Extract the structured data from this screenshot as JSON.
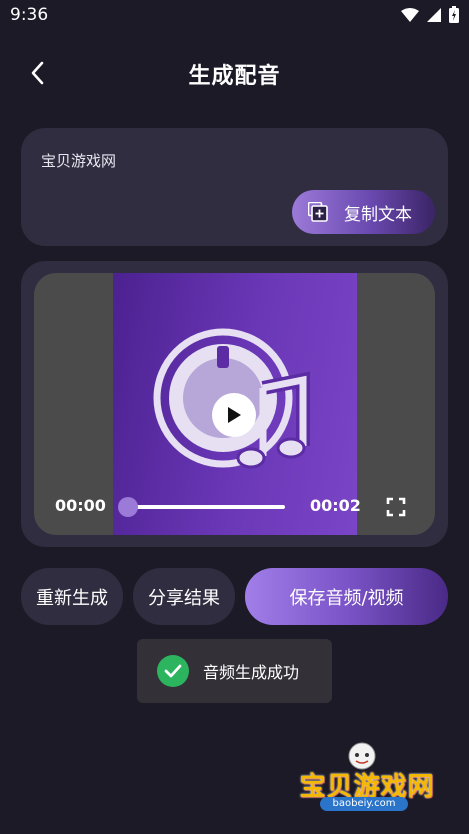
{
  "status": {
    "time": "9:36"
  },
  "header": {
    "title": "生成配音"
  },
  "text_card": {
    "content": "宝贝游戏网",
    "copy_label": "复制文本"
  },
  "player": {
    "current_time": "00:00",
    "duration": "00:02",
    "progress": 0
  },
  "actions": {
    "regen_label": "重新生成",
    "share_label": "分享结果",
    "save_label": "保存音频/视频"
  },
  "toast": {
    "message": "音频生成成功"
  },
  "watermark": {
    "brand": "宝贝游戏网",
    "url": "baobeiy.com"
  },
  "colors": {
    "background": "#1b1a26",
    "card": "#302d40",
    "accent": "#9b7ad8",
    "success": "#2cb45f"
  }
}
